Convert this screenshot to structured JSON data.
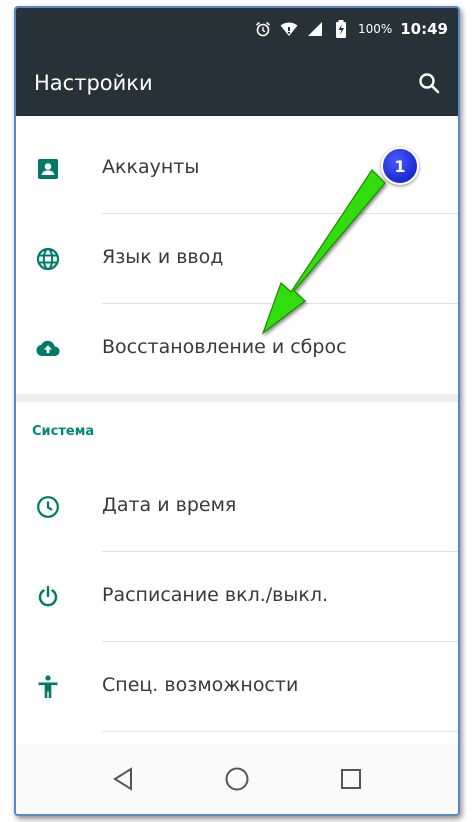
{
  "status_bar": {
    "battery_percent": "100%",
    "time": "10:49",
    "icons": [
      "alarm-icon",
      "wifi-icon",
      "signal-icon",
      "battery-icon"
    ]
  },
  "app_bar": {
    "title": "Настройки",
    "search_icon": "search-icon"
  },
  "section1": {
    "items": [
      {
        "label": "Аккаунты",
        "icon": "account-icon"
      },
      {
        "label": "Язык и ввод",
        "icon": "globe-icon"
      },
      {
        "label": "Восстановление и сброс",
        "icon": "cloud-upload-icon"
      }
    ]
  },
  "section2": {
    "header": "Система",
    "items": [
      {
        "label": "Дата и время",
        "icon": "clock-icon"
      },
      {
        "label": "Расписание вкл./выкл.",
        "icon": "power-icon"
      },
      {
        "label": "Спец. возможности",
        "icon": "accessibility-icon"
      }
    ]
  },
  "nav_bar": {
    "buttons": [
      "back-icon",
      "home-icon",
      "recents-icon"
    ]
  },
  "annotation": {
    "badge_number": "1",
    "arrow_color": "#33dd11",
    "badge_color": "#2233dd"
  },
  "colors": {
    "app_bar": "#263238",
    "accent": "#00897b",
    "icon": "#00796b"
  }
}
